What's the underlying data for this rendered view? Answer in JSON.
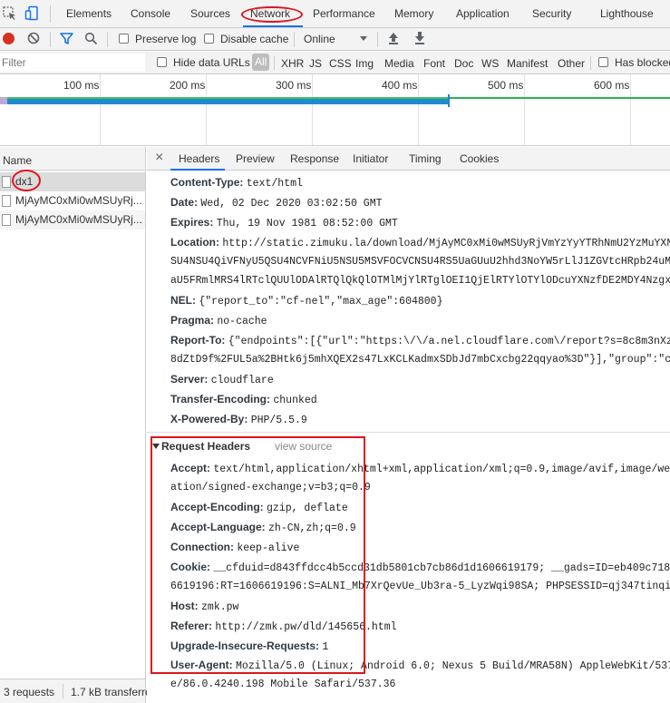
{
  "tabbar": {
    "tabs": [
      "Elements",
      "Console",
      "Sources",
      "Network",
      "Performance",
      "Memory",
      "Application",
      "Security",
      "Lighthouse"
    ],
    "active": "Network"
  },
  "toolbar": {
    "preserve_log": "Preserve log",
    "disable_cache": "Disable cache",
    "throttling": "Online"
  },
  "filterbar": {
    "placeholder": "Filter",
    "hide_data_urls": "Hide data URLs",
    "types": [
      "All",
      "XHR",
      "JS",
      "CSS",
      "Img",
      "Media",
      "Font",
      "Doc",
      "WS",
      "Manifest",
      "Other"
    ],
    "has_blocked": "Has blocked"
  },
  "overview": {
    "ticks": [
      "100 ms",
      "200 ms",
      "300 ms",
      "400 ms",
      "500 ms",
      "600 ms"
    ]
  },
  "requests": {
    "column_header": "Name",
    "items": [
      "dx1",
      "MjAyMC0xMi0wMSUyRj...",
      "MjAyMC0xMi0wMSUyRj..."
    ],
    "selected_index": 0,
    "status_count": "3 requests",
    "status_size": "1.7 kB transferre"
  },
  "details": {
    "close_glyph": "×",
    "tabs": [
      "Headers",
      "Preview",
      "Response",
      "Initiator",
      "Timing",
      "Cookies"
    ],
    "active_tab": "Headers",
    "response_headers": [
      {
        "name": "Content-Type:",
        "value": "text/html"
      },
      {
        "name": "Date:",
        "value": "Wed, 02 Dec 2020 03:02:50 GMT"
      },
      {
        "name": "Expires:",
        "value": "Thu, 19 Nov 1981 08:52:00 GMT"
      },
      {
        "name": "Location:",
        "value": "http://static.zimuku.la/download/MjAyMC0xMi0wMSUyRjVmYzYyYTRhNmU2YzMuYXNzfC"
      },
      {
        "name": "",
        "value": "SU4NSU4QiVFNyU5QSU4NCVFNiU5NSU5MSVFOCVCNSU4RS5UaGUuU2hhd3NoYW5rLlJ1ZGVtcHRpb24uMTk5N"
      },
      {
        "name": "",
        "value": "aU5FRmlMRS4lRTclQUUlODAlRTQlQkQlOTMlMjYlRTglOEI1QjElRTYlOTYlODcuYXNzfDE2MDY4NzgxNjh8"
      },
      {
        "name": "NEL:",
        "value": "{\"report_to\":\"cf-nel\",\"max_age\":604800}"
      },
      {
        "name": "Pragma:",
        "value": "no-cache"
      },
      {
        "name": "Report-To:",
        "value": "{\"endpoints\":[{\"url\":\"https:\\/\\/a.nel.cloudflare.com\\/report?s=8c8m3nXzoTl"
      },
      {
        "name": "",
        "value": "8dZtD9f%2FUL5a%2BHtk6j5mhXQEX2s47LxKCLKadmxSDbJd7mbCxcbg22qqyao%3D\"}],\"group\":\"cf-ne"
      },
      {
        "name": "Server:",
        "value": "cloudflare"
      },
      {
        "name": "Transfer-Encoding:",
        "value": "chunked"
      },
      {
        "name": "X-Powered-By:",
        "value": "PHP/5.5.9"
      }
    ],
    "request_section_title": "Request Headers",
    "view_source": "view source",
    "request_headers": [
      {
        "name": "Accept:",
        "value": "text/html,application/xhtml+xml,application/xml;q=0.9,image/avif,image/webp,i"
      },
      {
        "name": "",
        "value": "ation/signed-exchange;v=b3;q=0.9"
      },
      {
        "name": "Accept-Encoding:",
        "value": "gzip, deflate"
      },
      {
        "name": "Accept-Language:",
        "value": "zh-CN,zh;q=0.9"
      },
      {
        "name": "Connection:",
        "value": "keep-alive"
      },
      {
        "name": "Cookie:",
        "value": "__cfduid=d843ffdcc4b5ccd31db5801cb7cb86d1d1606619179; __gads=ID=eb409c7182ae6"
      },
      {
        "name": "",
        "value": "6619196:RT=1606619196:S=ALNI_Mb7XrQevUe_Ub3ra-5_LyzWqi98SA; PHPSESSID=qj347tinqim574"
      },
      {
        "name": "Host:",
        "value": "zmk.pw"
      },
      {
        "name": "Referer:",
        "value": "http://zmk.pw/dld/145656.html"
      },
      {
        "name": "Upgrade-Insecure-Requests:",
        "value": "1"
      },
      {
        "name": "User-Agent:",
        "value": "Mozilla/5.0 (Linux; Android 6.0; Nexus 5 Build/MRA58N) AppleWebKit/537.36"
      },
      {
        "name": "",
        "value": "e/86.0.4240.198 Mobile Safari/537.36"
      }
    ]
  },
  "colors": {
    "accent": "#1a73e8",
    "annotation": "#e0141e",
    "record": "#d93025",
    "timeline_bar": "#1e8bd0",
    "timeline_green": "#2bb24c"
  }
}
